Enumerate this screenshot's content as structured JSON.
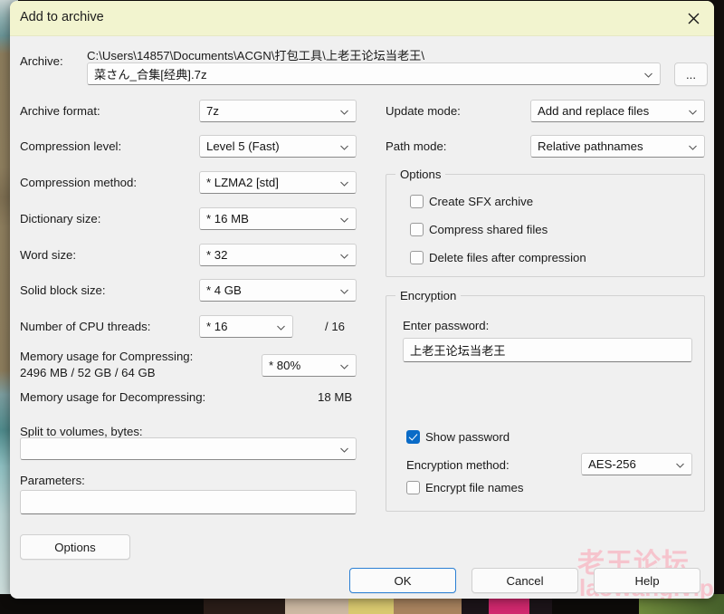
{
  "window": {
    "title": "Add to archive",
    "close_icon": "close-icon"
  },
  "archive": {
    "label": "Archive:",
    "path": "C:\\Users\\14857\\Documents\\ACGN\\打包工具\\上老王论坛当老王\\",
    "filename": "菜さん_合集[经典].7z",
    "browse_label": "..."
  },
  "left_column": {
    "archive_format": {
      "label": "Archive format:",
      "value": "7z"
    },
    "compression_level": {
      "label": "Compression level:",
      "value": "Level 5 (Fast)"
    },
    "compression_method": {
      "label": "Compression method:",
      "value": "* LZMA2 [std]"
    },
    "dictionary_size": {
      "label": "Dictionary size:",
      "value": "* 16 MB"
    },
    "word_size": {
      "label": "Word size:",
      "value": "* 32"
    },
    "solid_block_size": {
      "label": "Solid block size:",
      "value": "* 4 GB"
    },
    "cpu_threads": {
      "label": "Number of CPU threads:",
      "value": "* 16",
      "total": "/ 16"
    },
    "memory_compress": {
      "label": "Memory usage for Compressing:",
      "value": "2496 MB / 52 GB / 64 GB",
      "percent": "* 80%"
    },
    "memory_decompress": {
      "label": "Memory usage for Decompressing:",
      "value": "18 MB"
    },
    "split_volumes": {
      "label": "Split to volumes, bytes:",
      "value": ""
    },
    "parameters": {
      "label": "Parameters:",
      "value": ""
    },
    "options_button": "Options"
  },
  "right_column": {
    "update_mode": {
      "label": "Update mode:",
      "value": "Add and replace files"
    },
    "path_mode": {
      "label": "Path mode:",
      "value": "Relative pathnames"
    },
    "options_group": {
      "title": "Options",
      "checkboxes": [
        {
          "label": "Create SFX archive",
          "checked": false
        },
        {
          "label": "Compress shared files",
          "checked": false
        },
        {
          "label": "Delete files after compression",
          "checked": false
        }
      ]
    },
    "encryption_group": {
      "title": "Encryption",
      "password_label": "Enter password:",
      "password_value": "上老王论坛当老王",
      "show_password": {
        "label": "Show password",
        "checked": true
      },
      "encryption_method": {
        "label": "Encryption method:",
        "value": "AES-256"
      },
      "encrypt_file_names": {
        "label": "Encrypt file names",
        "checked": false
      }
    }
  },
  "footer": {
    "ok": "OK",
    "cancel": "Cancel",
    "help": "Help"
  },
  "watermark": {
    "cn": "老王论坛",
    "en": "laowang.vip",
    "color": "#f6c4cd"
  },
  "colors": {
    "titlebar_bg": "#f2f4cf",
    "dialog_bg": "#f0f0f0",
    "accent": "#0a6bc7",
    "focus_border": "#2a7fd4"
  }
}
